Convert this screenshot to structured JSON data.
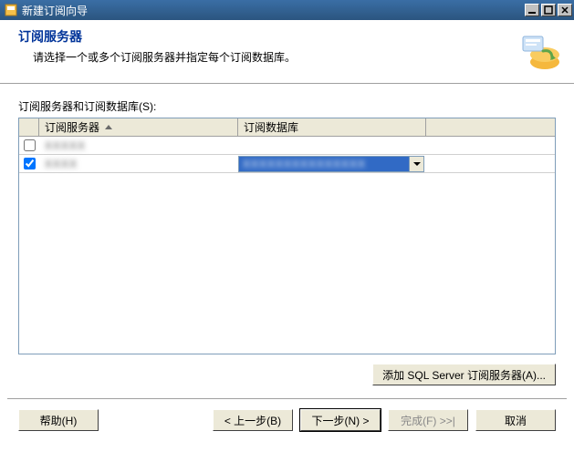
{
  "window": {
    "title": "新建订阅向导"
  },
  "header": {
    "title": "订阅服务器",
    "subtitle": "请选择一个或多个订阅服务器并指定每个订阅数据库。"
  },
  "section": {
    "label": "订阅服务器和订阅数据库(S):"
  },
  "grid": {
    "columns": {
      "server": "订阅服务器",
      "database": "订阅数据库"
    },
    "rows": [
      {
        "checked": false,
        "server": "",
        "database": ""
      },
      {
        "checked": true,
        "server": "",
        "database": ""
      }
    ]
  },
  "buttons": {
    "add_server": "添加 SQL Server 订阅服务器(A)...",
    "help": "帮助(H)",
    "back": "< 上一步(B)",
    "next": "下一步(N) >",
    "finish": "完成(F) >>|",
    "cancel": "取消"
  }
}
